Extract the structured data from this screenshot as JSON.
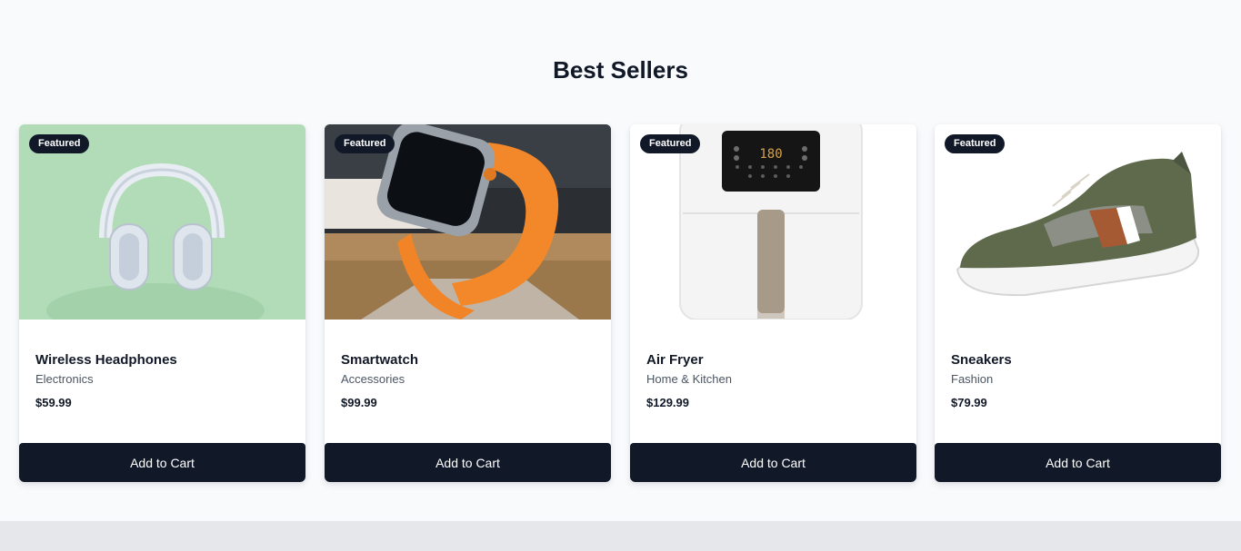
{
  "section": {
    "title": "Best Sellers"
  },
  "products": [
    {
      "badge": "Featured",
      "name": "Wireless Headphones",
      "category": "Electronics",
      "price": "$59.99",
      "button": "Add to Cart",
      "image_icon": "headphones-image"
    },
    {
      "badge": "Featured",
      "name": "Smartwatch",
      "category": "Accessories",
      "price": "$99.99",
      "button": "Add to Cart",
      "image_icon": "smartwatch-image"
    },
    {
      "badge": "Featured",
      "name": "Air Fryer",
      "category": "Home & Kitchen",
      "price": "$129.99",
      "button": "Add to Cart",
      "image_icon": "air-fryer-image",
      "display_readout": "180"
    },
    {
      "badge": "Featured",
      "name": "Sneakers",
      "category": "Fashion",
      "price": "$79.99",
      "button": "Add to Cart",
      "image_icon": "sneaker-image"
    }
  ],
  "colors": {
    "accent": "#111827",
    "background": "#f8fafc",
    "footer": "#e5e7eb"
  }
}
